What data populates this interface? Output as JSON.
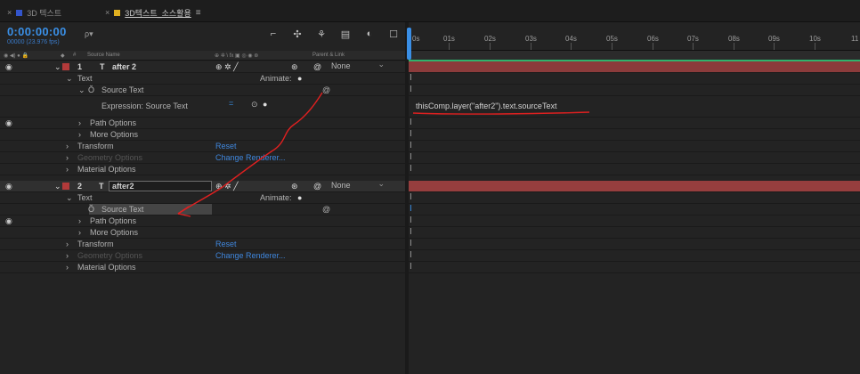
{
  "tabs": [
    {
      "close": "×",
      "color": "#3355cc",
      "label": "3D 텍스트",
      "active": false,
      "menu": ""
    },
    {
      "close": "×",
      "color": "#e0b020",
      "label": "3D텍스트_소스활용",
      "active": true,
      "menu": "≡"
    }
  ],
  "timecode": "0:00:00:00",
  "fps": "00000 (23.976 fps)",
  "search_placeholder": "ρ▾",
  "tool_icons": [
    "comp-mini-flowchart-icon",
    "draft-3d-icon",
    "shy-icon",
    "frame-blend-icon",
    "motion-blur-icon",
    "graph-editor-icon"
  ],
  "tool_glyphs": [
    "⌐",
    "✣",
    "⚘",
    "▤",
    "◐",
    "☐"
  ],
  "column_headers": {
    "av": "◉ ◀) ● 🔒",
    "label": "◆",
    "hash": "#",
    "source_name": "Source Name",
    "switches": "⊕ ✲ \\ fx ▣ ◎ ◉ ⊛",
    "parent": "Parent & Link"
  },
  "layer1": {
    "num": "1",
    "type": "T",
    "name": "after 2",
    "switches": "⊕ ✲ ╱",
    "parent_icon": "@",
    "parent": "None",
    "switch_icon": "⊛"
  },
  "layer2": {
    "num": "2",
    "type": "T",
    "name": "after2",
    "switches": "⊕ ✲ ╱",
    "parent_icon": "@",
    "parent": "None",
    "switch_icon": "⊛"
  },
  "rows": {
    "text1": "Text",
    "animate1": "Animate:",
    "source_text1": "Source Text",
    "expression_label": "Expression: Source Text",
    "expr_equals": "=",
    "path_options1": "Path Options",
    "more_options1": "More Options",
    "transform1": "Transform",
    "reset1": "Reset",
    "geometry1": "Geometry Options",
    "change_renderer1": "Change Renderer...",
    "material1": "Material Options",
    "text2": "Text",
    "animate2": "Animate:",
    "source_text2": "Source Text",
    "path_options2": "Path Options",
    "more_options2": "More Options",
    "transform2": "Transform",
    "reset2": "Reset",
    "geometry2": "Geometry Options",
    "change_renderer2": "Change Renderer...",
    "material2": "Material Options"
  },
  "expression_text": "thisComp.layer(\"after2\").text.sourceText",
  "ruler_ticks": [
    "0s",
    "01s",
    "02s",
    "03s",
    "04s",
    "05s",
    "06s",
    "07s",
    "08s",
    "09s",
    "10s",
    "11"
  ],
  "colors": {
    "accent": "#3a8fe6",
    "layer_bar": "#8b3b3b",
    "label_red": "#b23a3a",
    "annotation": "#e02020",
    "work_area": "#2fb36c"
  }
}
